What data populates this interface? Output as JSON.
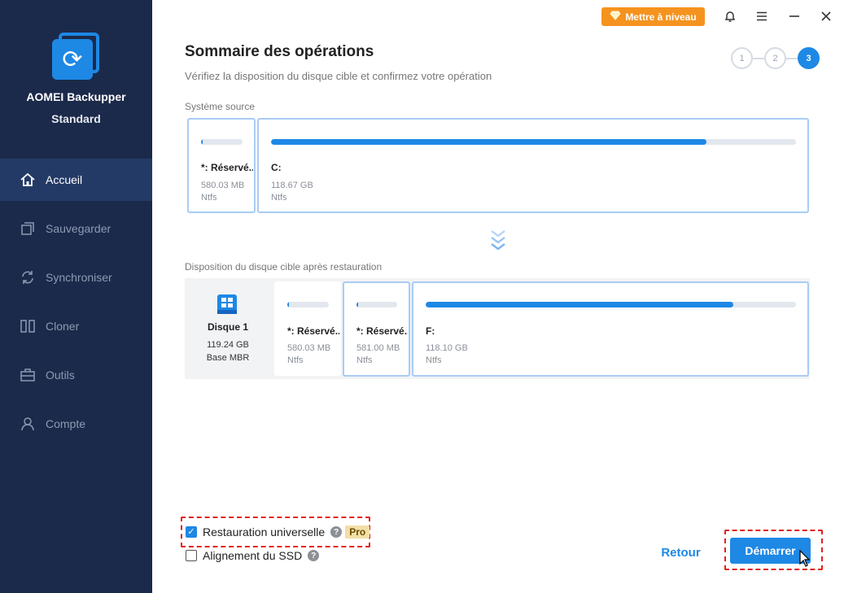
{
  "app": {
    "name": "AOMEI Backupper",
    "edition": "Standard"
  },
  "sidebar": {
    "items": [
      {
        "label": "Accueil",
        "icon": "home-icon",
        "active": true
      },
      {
        "label": "Sauvegarder",
        "icon": "backup-icon",
        "active": false
      },
      {
        "label": "Synchroniser",
        "icon": "sync-icon",
        "active": false
      },
      {
        "label": "Cloner",
        "icon": "clone-icon",
        "active": false
      },
      {
        "label": "Outils",
        "icon": "toolbox-icon",
        "active": false
      },
      {
        "label": "Compte",
        "icon": "user-icon",
        "active": false
      }
    ]
  },
  "topbar": {
    "upgrade_label": "Mettre à niveau",
    "icons": [
      "bell-icon",
      "menu-icon",
      "minimize-icon",
      "close-icon"
    ]
  },
  "header": {
    "title": "Sommaire des opérations",
    "subtitle": "Vérifiez la disposition du disque cible et confirmez votre opération"
  },
  "steps": [
    {
      "label": "1",
      "active": false
    },
    {
      "label": "2",
      "active": false
    },
    {
      "label": "3",
      "active": true
    }
  ],
  "source": {
    "label": "Système source",
    "partitions": [
      {
        "name": "*: Réservé...",
        "size": "580.03 MB",
        "fs": "Ntfs",
        "usage": 0.03
      },
      {
        "name": "C:",
        "size": "118.67 GB",
        "fs": "Ntfs",
        "usage": 0.83
      }
    ]
  },
  "target": {
    "label": "Disposition du disque cible après restauration",
    "disk": {
      "name": "Disque 1",
      "size": "119.24 GB",
      "type": "Base MBR"
    },
    "partitions": [
      {
        "name": "*: Réservé...",
        "size": "580.03 MB",
        "fs": "Ntfs",
        "usage": 0.03
      },
      {
        "name": "*: Réservé...",
        "size": "581.00 MB",
        "fs": "Ntfs",
        "usage": 0.03
      },
      {
        "name": "F:",
        "size": "118.10 GB",
        "fs": "Ntfs",
        "usage": 0.83
      }
    ]
  },
  "options": {
    "universal_restore": {
      "label": "Restauration universelle",
      "checked": true,
      "badge": "Pro"
    },
    "ssd_alignment": {
      "label": "Alignement du SSD",
      "checked": false
    }
  },
  "buttons": {
    "back": "Retour",
    "start": "Démarrer"
  },
  "colors": {
    "sidebar_bg": "#1b2a4a",
    "accent": "#1e88e5",
    "upgrade": "#f5931e",
    "highlight": "#e02020"
  }
}
